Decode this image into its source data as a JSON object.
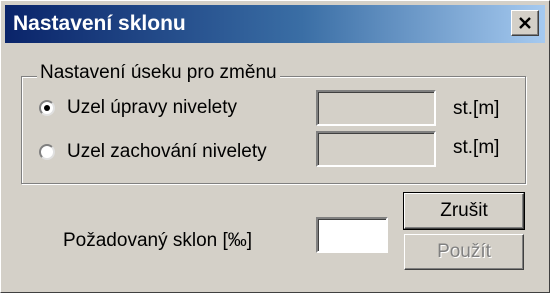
{
  "window": {
    "title": "Nastavení sklonu",
    "close_icon": "close-icon"
  },
  "group": {
    "legend": "Nastavení úseku pro změnu",
    "options": [
      {
        "label": "Uzel úpravy nivelety",
        "checked": true,
        "unit": "st.[m]",
        "value": ""
      },
      {
        "label": "Uzel zachování nivelety",
        "checked": false,
        "unit": "st.[m]",
        "value": ""
      }
    ]
  },
  "slope": {
    "label": "Požadovaný sklon  [‰]",
    "value": ""
  },
  "buttons": {
    "cancel": "Zrušit",
    "apply": "Použít"
  }
}
